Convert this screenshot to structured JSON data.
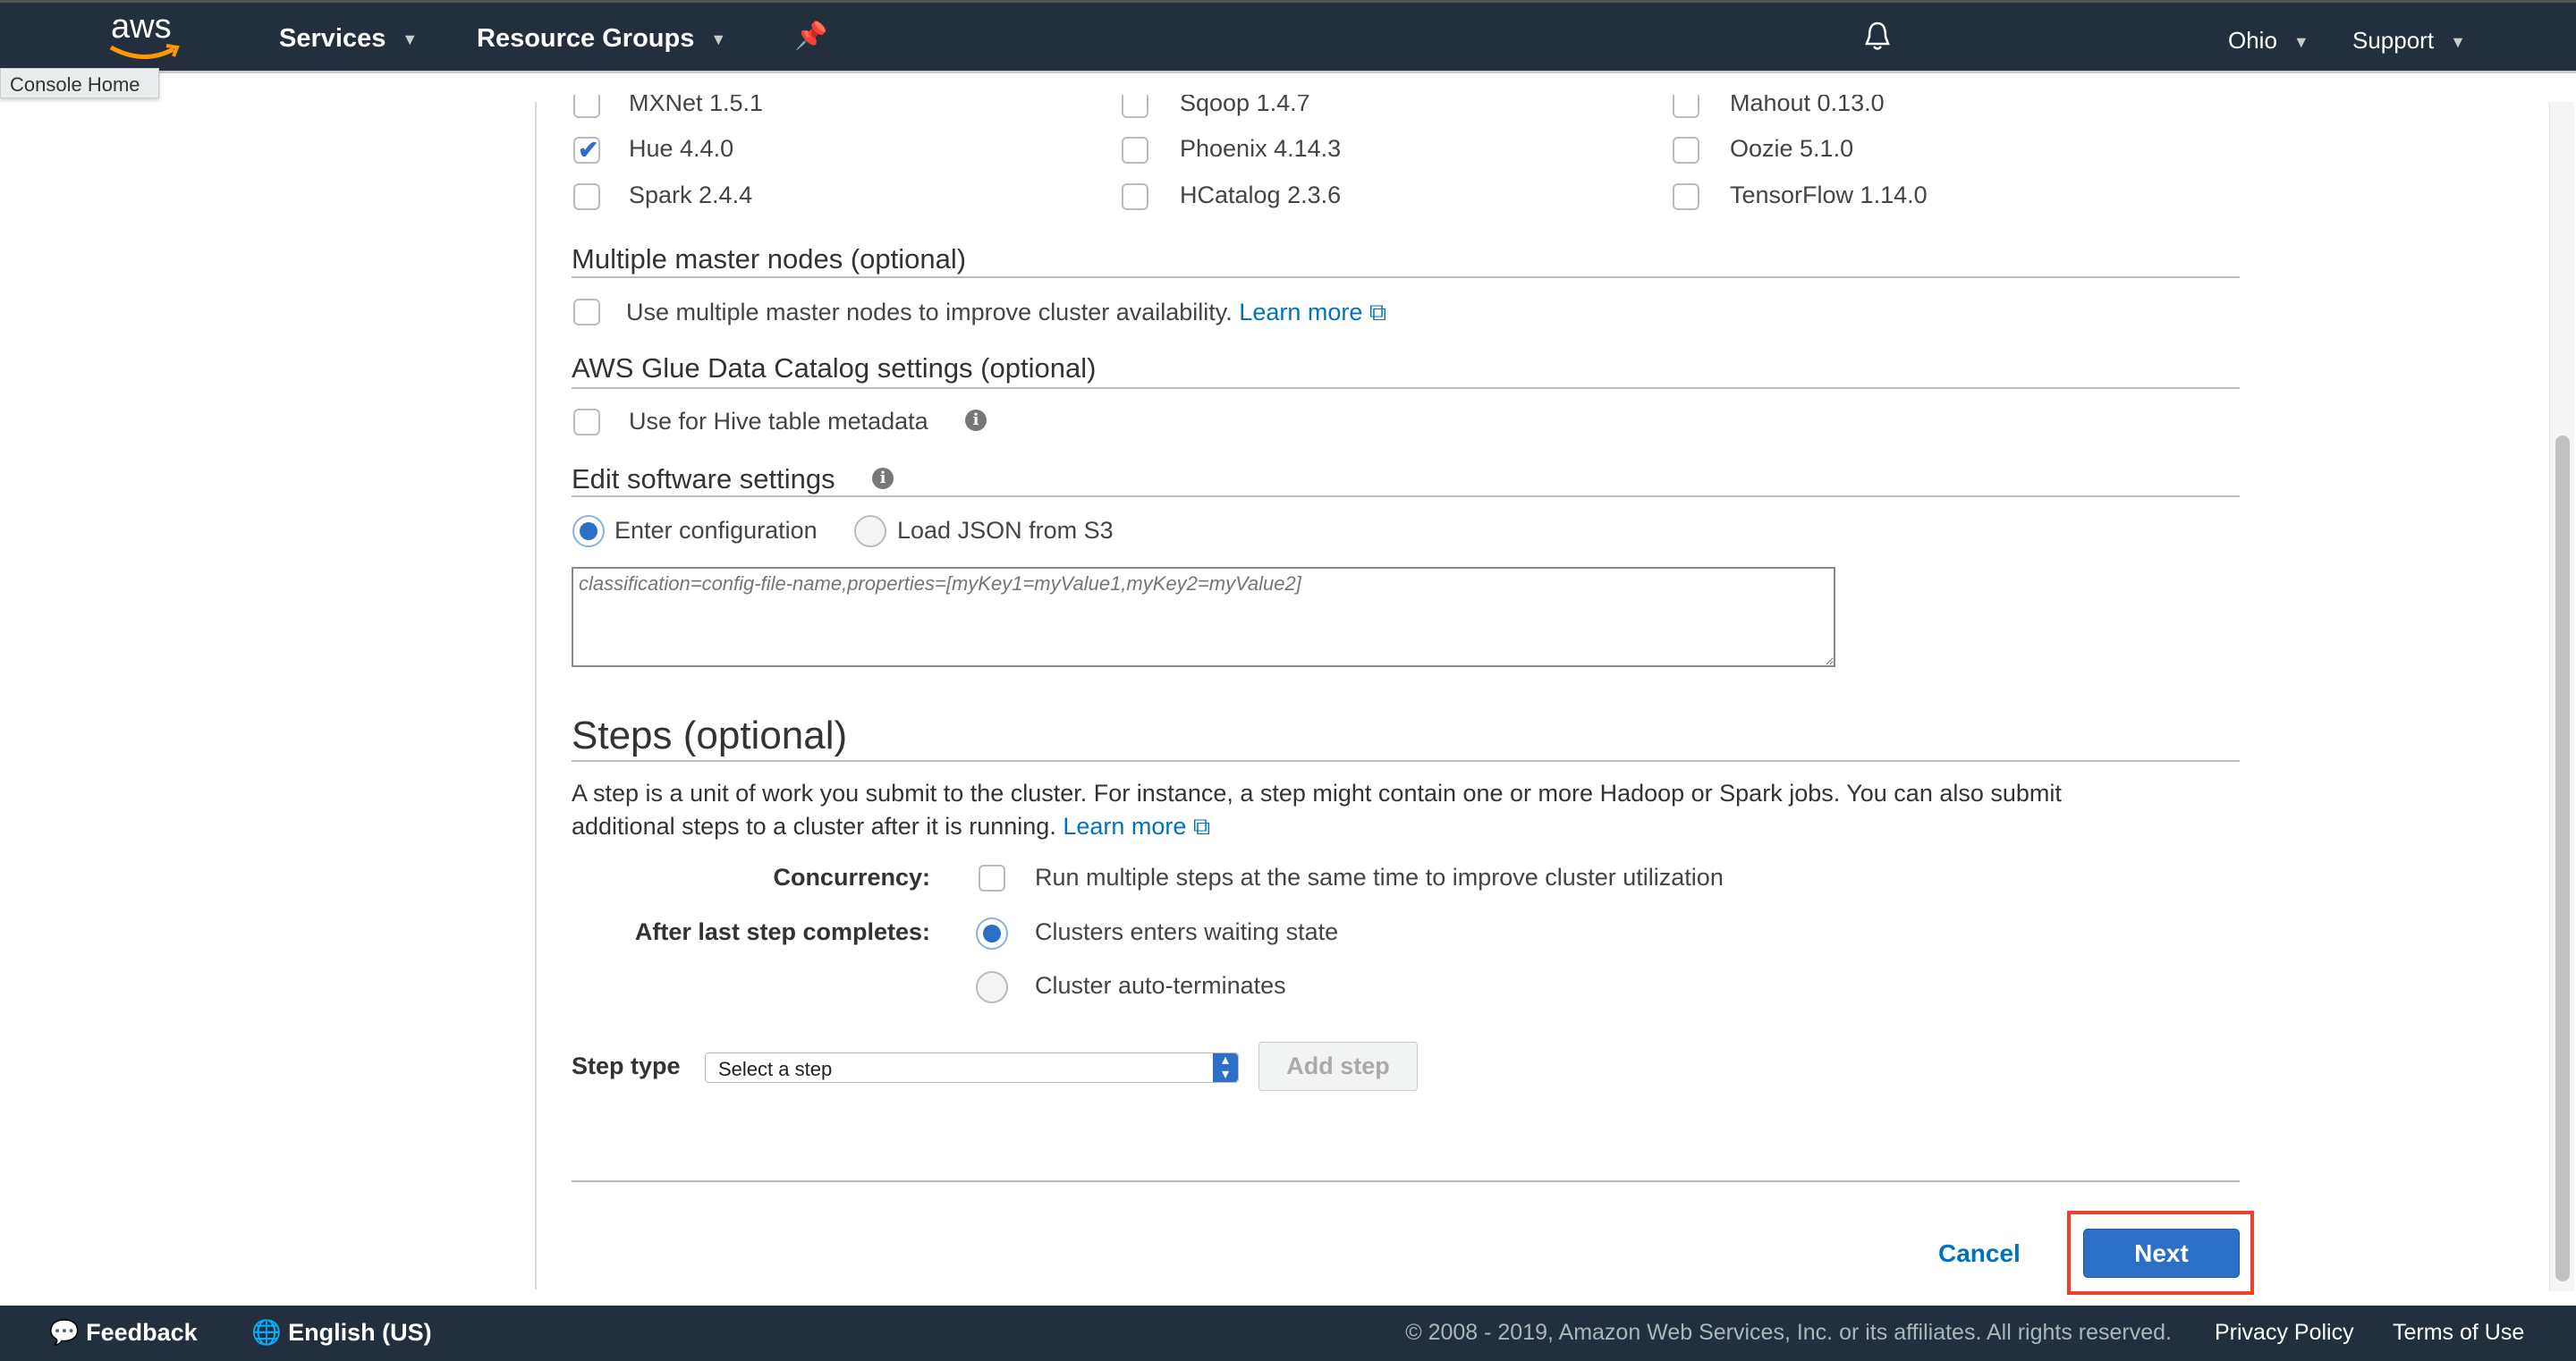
{
  "header": {
    "logo": "aws",
    "services": "Services",
    "resource_groups": "Resource Groups",
    "region": "Ohio",
    "support": "Support",
    "tooltip": "Console Home"
  },
  "apps": {
    "rows": [
      [
        {
          "label": "MXNet 1.5.1",
          "checked": false
        },
        {
          "label": "Sqoop 1.4.7",
          "checked": false
        },
        {
          "label": "Mahout 0.13.0",
          "checked": false
        }
      ],
      [
        {
          "label": "Hue 4.4.0",
          "checked": true
        },
        {
          "label": "Phoenix 4.14.3",
          "checked": false
        },
        {
          "label": "Oozie 5.1.0",
          "checked": false
        }
      ],
      [
        {
          "label": "Spark 2.4.4",
          "checked": false
        },
        {
          "label": "HCatalog 2.3.6",
          "checked": false
        },
        {
          "label": "TensorFlow 1.14.0",
          "checked": false
        }
      ]
    ]
  },
  "multi_master": {
    "heading": "Multiple master nodes (optional)",
    "option": "Use multiple master nodes to improve cluster availability.",
    "learn_more": "Learn more"
  },
  "glue": {
    "heading": "AWS Glue Data Catalog settings (optional)",
    "option": "Use for Hive table metadata"
  },
  "software": {
    "heading": "Edit software settings",
    "radio_enter": "Enter configuration",
    "radio_load": "Load JSON from S3",
    "placeholder": "classification=config-file-name,properties=[myKey1=myValue1,myKey2=myValue2]"
  },
  "steps": {
    "heading": "Steps (optional)",
    "desc1": "A step is a unit of work you submit to the cluster. For instance, a step might contain one or more Hadoop or Spark jobs. You can also submit",
    "desc2": "additional steps to a cluster after it is running.",
    "learn_more": "Learn more",
    "concurrency_label": "Concurrency:",
    "concurrency_option": "Run multiple steps at the same time to improve cluster utilization",
    "after_label": "After last step completes:",
    "after_waiting": "Clusters enters waiting state",
    "after_terminate": "Cluster auto-terminates",
    "step_type_label": "Step type",
    "step_select": "Select a step",
    "add_step": "Add step"
  },
  "actions": {
    "cancel": "Cancel",
    "next": "Next"
  },
  "footer": {
    "feedback": "Feedback",
    "language": "English (US)",
    "copyright": "© 2008 - 2019, Amazon Web Services, Inc. or its affiliates. All rights reserved.",
    "privacy": "Privacy Policy",
    "terms": "Terms of Use"
  },
  "colors": {
    "header_bg": "#232f3e",
    "link": "#0073bb",
    "primary": "#2c6fc6",
    "highlight": "#e8412c"
  }
}
